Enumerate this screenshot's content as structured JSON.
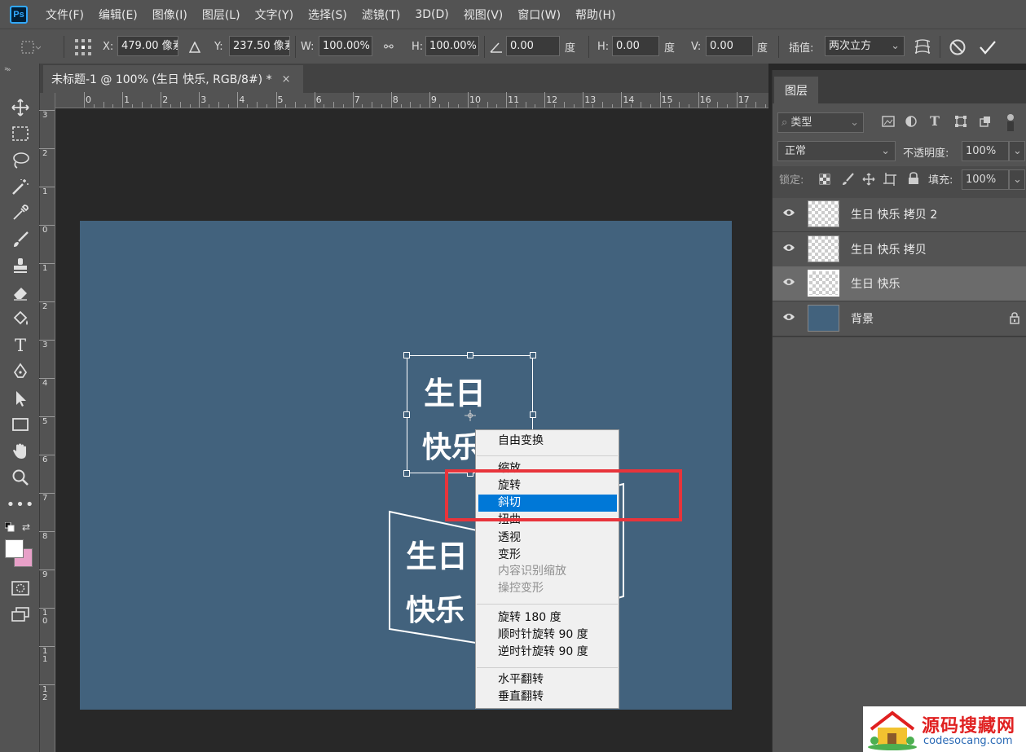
{
  "menubar": {
    "logo": "Ps",
    "items": [
      "文件(F)",
      "编辑(E)",
      "图像(I)",
      "图层(L)",
      "文字(Y)",
      "选择(S)",
      "滤镜(T)",
      "3D(D)",
      "视图(V)",
      "窗口(W)",
      "帮助(H)"
    ]
  },
  "options": {
    "x_label": "X:",
    "x_value": "479.00 像素",
    "y_label": "Y:",
    "y_value": "237.50 像素",
    "w_label": "W:",
    "w_value": "100.00%",
    "h_label": "H:",
    "h_value": "100.00%",
    "angle_value": "0.00",
    "angle_unit": "度",
    "hskew_label": "H:",
    "hskew_value": "0.00",
    "hskew_unit": "度",
    "vskew_label": "V:",
    "vskew_value": "0.00",
    "vskew_unit": "度",
    "interp_label": "插值:",
    "interp_value": "两次立方"
  },
  "document": {
    "tab_title": "未标题-1 @ 100% (生日 快乐, RGB/8#) *",
    "close": "×"
  },
  "rulers": {
    "top": [
      "0",
      "1",
      "2",
      "3",
      "4",
      "5",
      "6",
      "7",
      "8",
      "9",
      "10",
      "11",
      "12",
      "13",
      "14",
      "15",
      "16",
      "17"
    ],
    "left": [
      "3",
      "2",
      "1",
      "0",
      "1",
      "2",
      "3",
      "4",
      "5",
      "6",
      "7",
      "8",
      "9",
      "10",
      "11",
      "12"
    ]
  },
  "canvas": {
    "artboard_color": "#42627d",
    "text_line1": "生日",
    "text_line2": "快乐"
  },
  "context_menu": {
    "items": [
      {
        "label": "自由变换",
        "state": "normal"
      },
      {
        "label": "缩放",
        "state": "normal"
      },
      {
        "label": "旋转",
        "state": "normal"
      },
      {
        "label": "斜切",
        "state": "highlighted"
      },
      {
        "label": "扭曲",
        "state": "normal"
      },
      {
        "label": "透视",
        "state": "normal"
      },
      {
        "label": "变形",
        "state": "normal"
      },
      {
        "label": "内容识别缩放",
        "state": "disabled"
      },
      {
        "label": "操控变形",
        "state": "disabled"
      },
      {
        "label": "旋转 180 度",
        "state": "normal"
      },
      {
        "label": "顺时针旋转 90 度",
        "state": "normal"
      },
      {
        "label": "逆时针旋转 90 度",
        "state": "normal"
      },
      {
        "label": "水平翻转",
        "state": "normal"
      },
      {
        "label": "垂直翻转",
        "state": "normal"
      }
    ],
    "highlight_color": "#0078d7",
    "annotation_color": "#e8343b"
  },
  "layers_panel": {
    "tab": "图层",
    "filter_placeholder": "类型",
    "blend_mode": "正常",
    "opacity_label": "不透明度:",
    "opacity_value": "100%",
    "lock_label": "锁定:",
    "fill_label": "填充:",
    "fill_value": "100%",
    "layers": [
      {
        "name": "生日 快乐 拷贝 2",
        "selected": false
      },
      {
        "name": "生日 快乐 拷贝",
        "selected": false
      },
      {
        "name": "生日 快乐",
        "selected": true
      },
      {
        "name": "背景",
        "selected": false,
        "locked": true
      }
    ]
  },
  "watermark": {
    "title": "源码搜藏网",
    "url": "codesocang.com"
  }
}
